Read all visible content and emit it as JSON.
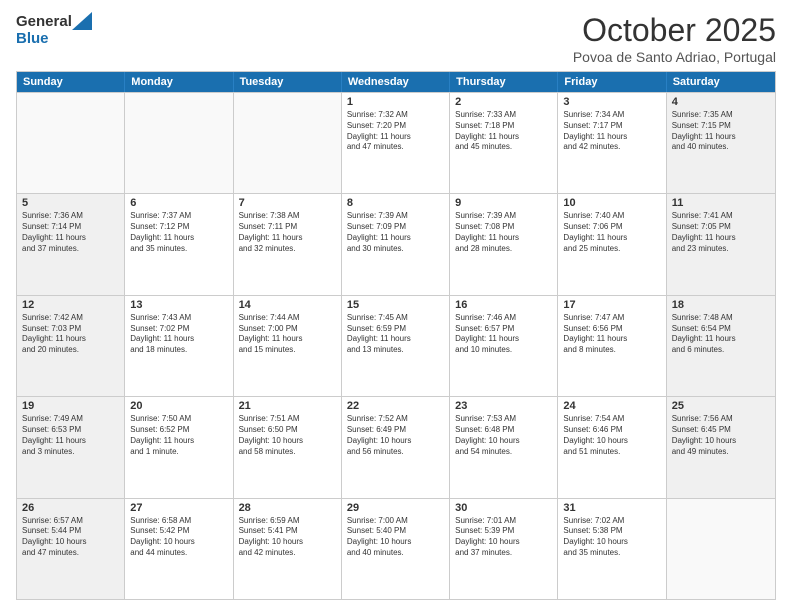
{
  "header": {
    "logo_general": "General",
    "logo_blue": "Blue",
    "title": "October 2025",
    "subtitle": "Povoa de Santo Adriao, Portugal"
  },
  "weekdays": [
    "Sunday",
    "Monday",
    "Tuesday",
    "Wednesday",
    "Thursday",
    "Friday",
    "Saturday"
  ],
  "rows": [
    [
      {
        "day": "",
        "lines": [],
        "empty": true
      },
      {
        "day": "",
        "lines": [],
        "empty": true
      },
      {
        "day": "",
        "lines": [],
        "empty": true
      },
      {
        "day": "1",
        "lines": [
          "Sunrise: 7:32 AM",
          "Sunset: 7:20 PM",
          "Daylight: 11 hours",
          "and 47 minutes."
        ]
      },
      {
        "day": "2",
        "lines": [
          "Sunrise: 7:33 AM",
          "Sunset: 7:18 PM",
          "Daylight: 11 hours",
          "and 45 minutes."
        ]
      },
      {
        "day": "3",
        "lines": [
          "Sunrise: 7:34 AM",
          "Sunset: 7:17 PM",
          "Daylight: 11 hours",
          "and 42 minutes."
        ]
      },
      {
        "day": "4",
        "lines": [
          "Sunrise: 7:35 AM",
          "Sunset: 7:15 PM",
          "Daylight: 11 hours",
          "and 40 minutes."
        ],
        "shaded": true
      }
    ],
    [
      {
        "day": "5",
        "lines": [
          "Sunrise: 7:36 AM",
          "Sunset: 7:14 PM",
          "Daylight: 11 hours",
          "and 37 minutes."
        ],
        "shaded": true
      },
      {
        "day": "6",
        "lines": [
          "Sunrise: 7:37 AM",
          "Sunset: 7:12 PM",
          "Daylight: 11 hours",
          "and 35 minutes."
        ]
      },
      {
        "day": "7",
        "lines": [
          "Sunrise: 7:38 AM",
          "Sunset: 7:11 PM",
          "Daylight: 11 hours",
          "and 32 minutes."
        ]
      },
      {
        "day": "8",
        "lines": [
          "Sunrise: 7:39 AM",
          "Sunset: 7:09 PM",
          "Daylight: 11 hours",
          "and 30 minutes."
        ]
      },
      {
        "day": "9",
        "lines": [
          "Sunrise: 7:39 AM",
          "Sunset: 7:08 PM",
          "Daylight: 11 hours",
          "and 28 minutes."
        ]
      },
      {
        "day": "10",
        "lines": [
          "Sunrise: 7:40 AM",
          "Sunset: 7:06 PM",
          "Daylight: 11 hours",
          "and 25 minutes."
        ]
      },
      {
        "day": "11",
        "lines": [
          "Sunrise: 7:41 AM",
          "Sunset: 7:05 PM",
          "Daylight: 11 hours",
          "and 23 minutes."
        ],
        "shaded": true
      }
    ],
    [
      {
        "day": "12",
        "lines": [
          "Sunrise: 7:42 AM",
          "Sunset: 7:03 PM",
          "Daylight: 11 hours",
          "and 20 minutes."
        ],
        "shaded": true
      },
      {
        "day": "13",
        "lines": [
          "Sunrise: 7:43 AM",
          "Sunset: 7:02 PM",
          "Daylight: 11 hours",
          "and 18 minutes."
        ]
      },
      {
        "day": "14",
        "lines": [
          "Sunrise: 7:44 AM",
          "Sunset: 7:00 PM",
          "Daylight: 11 hours",
          "and 15 minutes."
        ]
      },
      {
        "day": "15",
        "lines": [
          "Sunrise: 7:45 AM",
          "Sunset: 6:59 PM",
          "Daylight: 11 hours",
          "and 13 minutes."
        ]
      },
      {
        "day": "16",
        "lines": [
          "Sunrise: 7:46 AM",
          "Sunset: 6:57 PM",
          "Daylight: 11 hours",
          "and 10 minutes."
        ]
      },
      {
        "day": "17",
        "lines": [
          "Sunrise: 7:47 AM",
          "Sunset: 6:56 PM",
          "Daylight: 11 hours",
          "and 8 minutes."
        ]
      },
      {
        "day": "18",
        "lines": [
          "Sunrise: 7:48 AM",
          "Sunset: 6:54 PM",
          "Daylight: 11 hours",
          "and 6 minutes."
        ],
        "shaded": true
      }
    ],
    [
      {
        "day": "19",
        "lines": [
          "Sunrise: 7:49 AM",
          "Sunset: 6:53 PM",
          "Daylight: 11 hours",
          "and 3 minutes."
        ],
        "shaded": true
      },
      {
        "day": "20",
        "lines": [
          "Sunrise: 7:50 AM",
          "Sunset: 6:52 PM",
          "Daylight: 11 hours",
          "and 1 minute."
        ]
      },
      {
        "day": "21",
        "lines": [
          "Sunrise: 7:51 AM",
          "Sunset: 6:50 PM",
          "Daylight: 10 hours",
          "and 58 minutes."
        ]
      },
      {
        "day": "22",
        "lines": [
          "Sunrise: 7:52 AM",
          "Sunset: 6:49 PM",
          "Daylight: 10 hours",
          "and 56 minutes."
        ]
      },
      {
        "day": "23",
        "lines": [
          "Sunrise: 7:53 AM",
          "Sunset: 6:48 PM",
          "Daylight: 10 hours",
          "and 54 minutes."
        ]
      },
      {
        "day": "24",
        "lines": [
          "Sunrise: 7:54 AM",
          "Sunset: 6:46 PM",
          "Daylight: 10 hours",
          "and 51 minutes."
        ]
      },
      {
        "day": "25",
        "lines": [
          "Sunrise: 7:56 AM",
          "Sunset: 6:45 PM",
          "Daylight: 10 hours",
          "and 49 minutes."
        ],
        "shaded": true
      }
    ],
    [
      {
        "day": "26",
        "lines": [
          "Sunrise: 6:57 AM",
          "Sunset: 5:44 PM",
          "Daylight: 10 hours",
          "and 47 minutes."
        ],
        "shaded": true
      },
      {
        "day": "27",
        "lines": [
          "Sunrise: 6:58 AM",
          "Sunset: 5:42 PM",
          "Daylight: 10 hours",
          "and 44 minutes."
        ]
      },
      {
        "day": "28",
        "lines": [
          "Sunrise: 6:59 AM",
          "Sunset: 5:41 PM",
          "Daylight: 10 hours",
          "and 42 minutes."
        ]
      },
      {
        "day": "29",
        "lines": [
          "Sunrise: 7:00 AM",
          "Sunset: 5:40 PM",
          "Daylight: 10 hours",
          "and 40 minutes."
        ]
      },
      {
        "day": "30",
        "lines": [
          "Sunrise: 7:01 AM",
          "Sunset: 5:39 PM",
          "Daylight: 10 hours",
          "and 37 minutes."
        ]
      },
      {
        "day": "31",
        "lines": [
          "Sunrise: 7:02 AM",
          "Sunset: 5:38 PM",
          "Daylight: 10 hours",
          "and 35 minutes."
        ]
      },
      {
        "day": "",
        "lines": [],
        "empty": true
      }
    ]
  ]
}
